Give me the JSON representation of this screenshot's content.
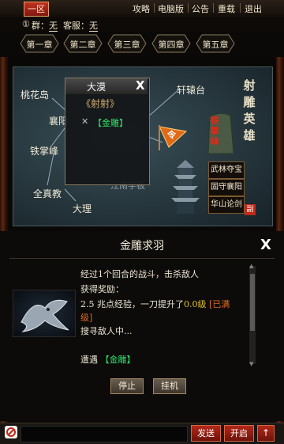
{
  "topbar": {
    "server_tab": "一区",
    "menu": [
      "攻略",
      "电脑版",
      "公告",
      "重载",
      "退出"
    ]
  },
  "info": {
    "group_icon": "①",
    "group_label": "群：",
    "group_value": "无",
    "kefu_label": "客服：",
    "kefu_value": "无"
  },
  "chapters": [
    "第一章",
    "第二章",
    "第三章",
    "第四章",
    "第五章"
  ],
  "map": {
    "places": {
      "taohuadao": "桃花岛",
      "xiangyang": "襄阳",
      "tiezhangfeng": "铁掌峰",
      "quanzhenjiao": "全真教",
      "dali": "大理",
      "xuanyuantai": "轩辕台",
      "hidden": "江南字板"
    },
    "title_vertical": [
      "射",
      "雕",
      "英",
      "雄"
    ],
    "stone_text": "铁\n掌\n峰",
    "flag_text": "令",
    "side_buttons": [
      "武林夺宝",
      "固守襄阳",
      "华山论剑"
    ],
    "seal": "副"
  },
  "popup": {
    "title": "大漠",
    "close": "X",
    "book": "《射射》",
    "item_icon": "✕",
    "item": "【金雕】"
  },
  "quest": {
    "title": "金雕求羽",
    "close": "X",
    "log": {
      "line1": "经过1个回合的战斗，击杀敌人",
      "line2": "获得奖励：",
      "line3_prefix": "2.5 兆点经验，一刀提升了",
      "line3_level": "0.0级",
      "line3_status": "[已满",
      "line4": "级]",
      "line5": "搜寻敌人中...",
      "line6_prefix": "遭遇",
      "line6_enemy": "【金雕】"
    },
    "buttons": {
      "stop": "停止",
      "auto": "挂机"
    }
  },
  "chat": {
    "send": "发送",
    "open": "开启",
    "top": "↑"
  },
  "colors": {
    "accent_red": "#b22818",
    "green": "#2ee06a",
    "gold": "#e0c020",
    "orange": "#e06a20"
  }
}
